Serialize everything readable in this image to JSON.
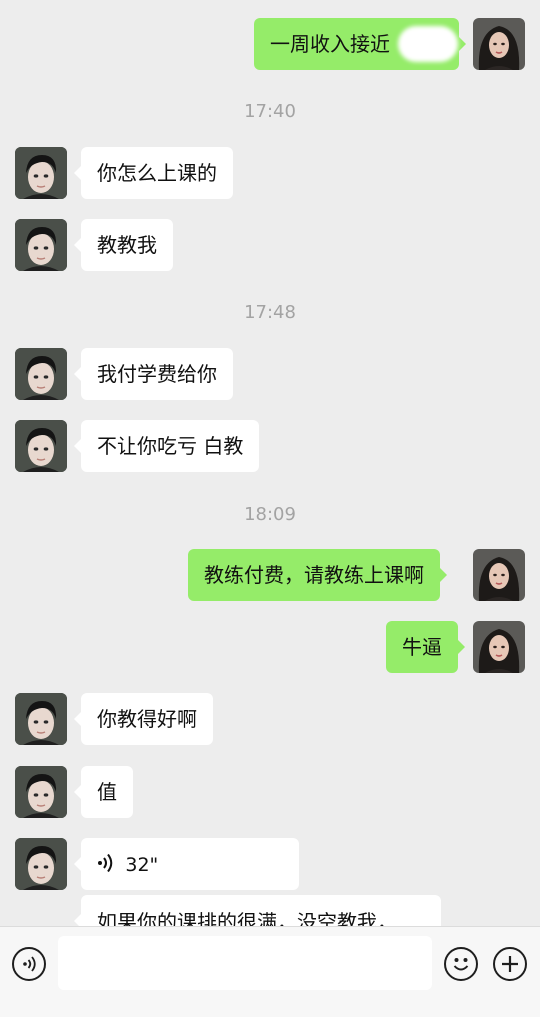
{
  "chat": {
    "messages": [
      {
        "text": "一周收入接近"
      },
      {
        "text": "你怎么上课的"
      },
      {
        "text": "教教我"
      },
      {
        "text": "我付学费给你"
      },
      {
        "text": "不让你吃亏 白教"
      },
      {
        "text": "教练付费，请教练上课啊"
      },
      {
        "text": "牛逼"
      },
      {
        "text": "你教得好啊"
      },
      {
        "text": "值"
      },
      {
        "text": "32\""
      },
      {
        "text": "如果你的课排的很满，没空教我，"
      }
    ],
    "times": [
      "17:40",
      "17:48",
      "18:09"
    ]
  },
  "input_bar": {
    "placeholder": "",
    "voice_icon": "voice-input-icon",
    "emoji_icon": "emoji-icon",
    "plus_icon": "plus-icon"
  },
  "colors": {
    "background": "#ededed",
    "outgoing_bubble": "#95ec69",
    "incoming_bubble": "#ffffff",
    "timestamp": "#a3a3a3"
  }
}
